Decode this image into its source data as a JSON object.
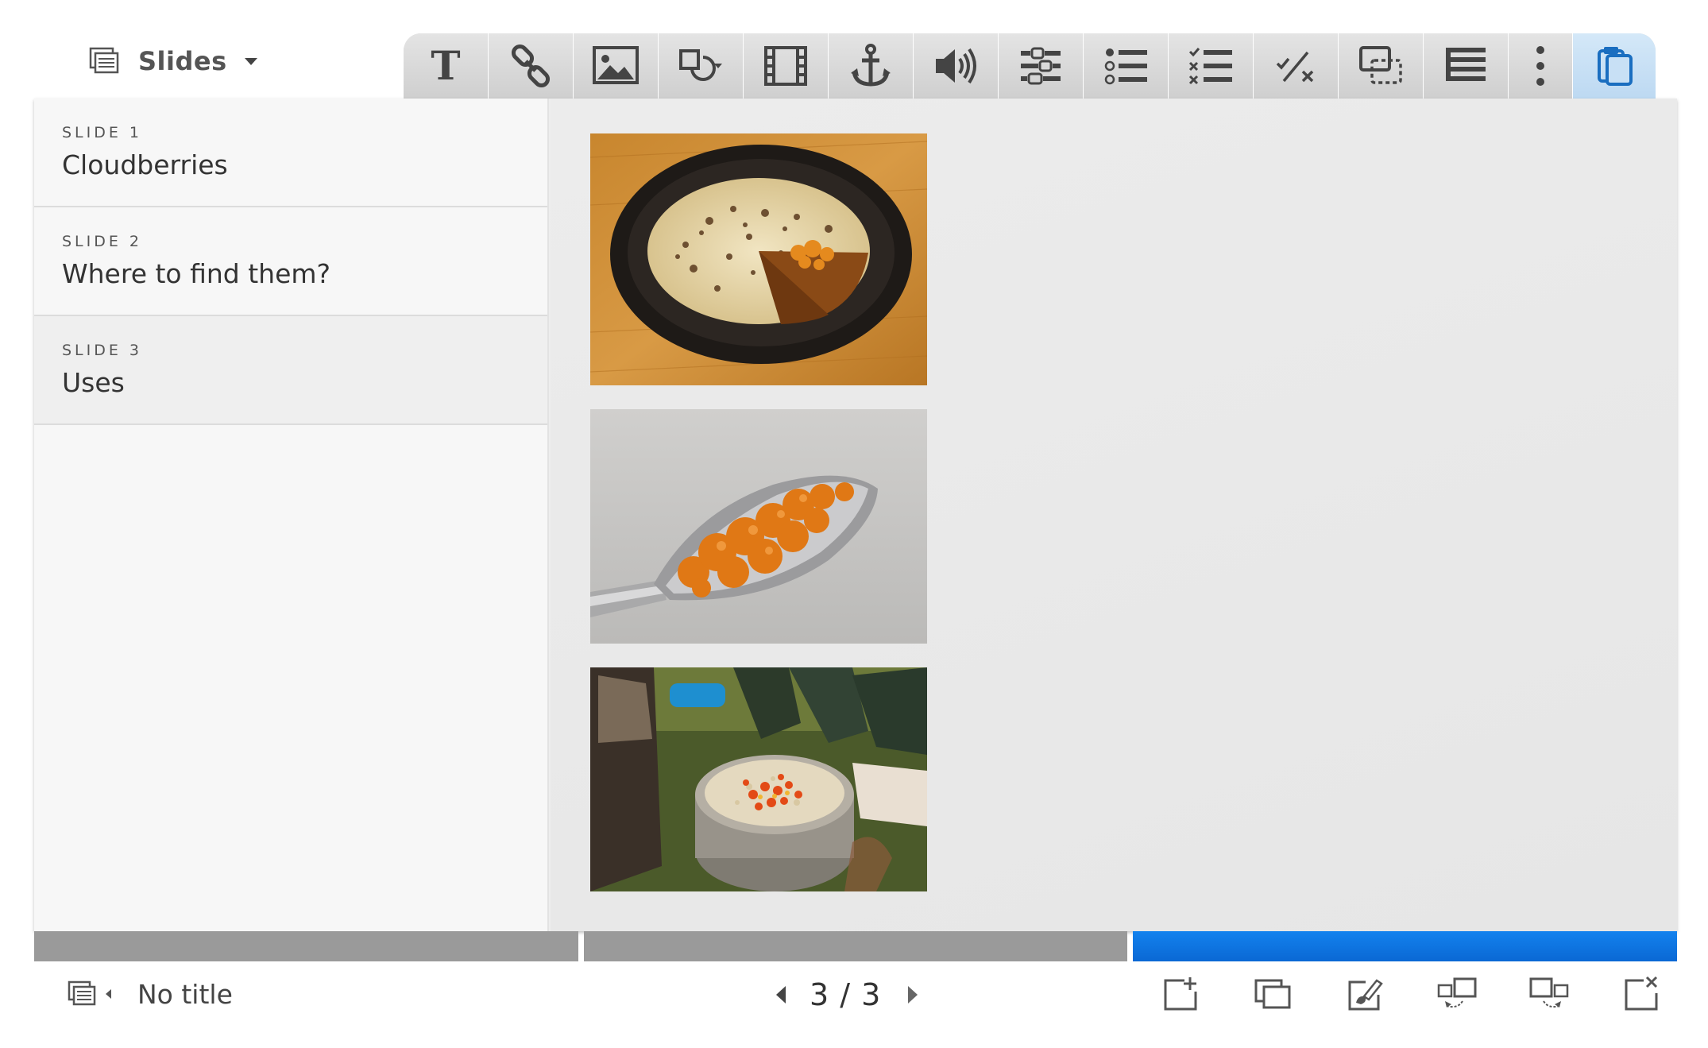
{
  "header": {
    "slides_menu_label": "Slides"
  },
  "toolbar": {
    "buttons": [
      {
        "name": "text-icon"
      },
      {
        "name": "link-icon"
      },
      {
        "name": "image-icon"
      },
      {
        "name": "shapes-icon"
      },
      {
        "name": "video-icon"
      },
      {
        "name": "anchor-icon"
      },
      {
        "name": "audio-icon"
      },
      {
        "name": "fill-in-blanks-icon"
      },
      {
        "name": "single-choice-icon"
      },
      {
        "name": "multiple-choice-icon"
      },
      {
        "name": "true-false-icon"
      },
      {
        "name": "drag-drop-icon"
      },
      {
        "name": "summary-icon"
      },
      {
        "name": "more-options-icon"
      },
      {
        "name": "paste-icon"
      }
    ]
  },
  "slides": [
    {
      "number": "SLIDE 1",
      "title": "Cloudberries"
    },
    {
      "number": "SLIDE 2",
      "title": "Where to find them?"
    },
    {
      "number": "SLIDE 3",
      "title": "Uses"
    }
  ],
  "canvas": {
    "images": [
      "cloudberry-cake-photo",
      "cloudberry-jam-spoon-photo",
      "cloudberry-porridge-photo"
    ]
  },
  "progress": {
    "segments": 3,
    "current": 3
  },
  "footer": {
    "title": "No title",
    "page_current": "3",
    "page_total": "3",
    "page_display": "3 / 3",
    "actions": [
      "add-slide-icon",
      "clone-slide-icon",
      "edit-background-icon",
      "move-slide-left-icon",
      "move-slide-right-icon",
      "delete-slide-icon"
    ]
  },
  "colors": {
    "accent_blue": "#0a6fd9",
    "progress_gray": "#9a9a9a",
    "toolbar_gray": "#d6d6d6",
    "active_tool": "#c8e0f5"
  }
}
